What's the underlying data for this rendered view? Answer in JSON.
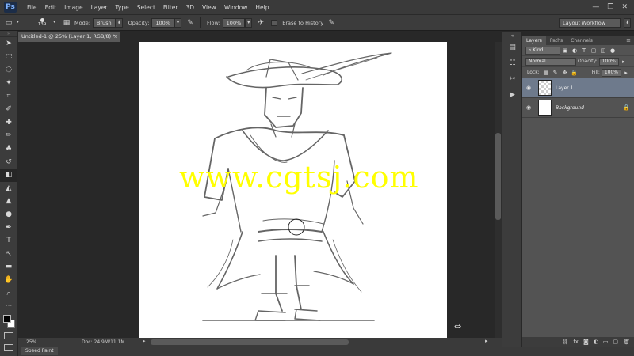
{
  "app": {
    "logo": "Ps"
  },
  "menu": [
    "File",
    "Edit",
    "Image",
    "Layer",
    "Type",
    "Select",
    "Filter",
    "3D",
    "View",
    "Window",
    "Help"
  ],
  "window_controls": {
    "minimize": "—",
    "restore": "❐",
    "close": "✕"
  },
  "options": {
    "brush_size": "139",
    "mode_label": "Mode:",
    "mode_value": "Brush",
    "opacity_label": "Opacity:",
    "opacity_value": "100%",
    "flow_label": "Flow:",
    "flow_value": "100%",
    "erase_history_label": "Erase to History",
    "workspace": "Layout Workflow"
  },
  "document": {
    "tab_title": "Untitled-1 @ 25% (Layer 1, RGB/8) *",
    "close": "×",
    "zoom": "25%",
    "doc_info": "Doc: 24.9M/11.1M",
    "watermark": "www.cgtsj.com"
  },
  "bottom": {
    "speed_paint": "Speed Paint"
  },
  "layers_panel": {
    "tabs": [
      "Layers",
      "Paths",
      "Channels"
    ],
    "kind_label": "Kind",
    "blend_mode": "Normal",
    "opacity_label": "Opacity:",
    "opacity_value": "100%",
    "lock_label": "Lock:",
    "fill_label": "Fill:",
    "fill_value": "100%",
    "layers": [
      {
        "name": "Layer 1",
        "selected": true
      },
      {
        "name": "Background",
        "selected": false
      }
    ]
  },
  "colors": {
    "accent_selection": "#6e7a8c",
    "watermark": "#ffff00",
    "canvas": "#ffffff"
  }
}
